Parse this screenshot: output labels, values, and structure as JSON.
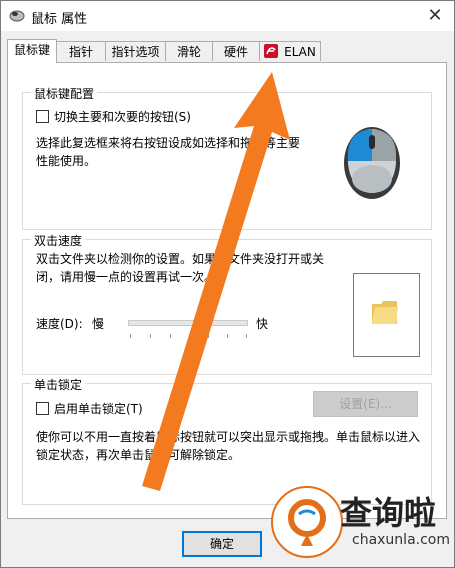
{
  "window": {
    "title": "鼠标 属性",
    "close_glyph": "✕"
  },
  "tabs": [
    {
      "label": "鼠标键",
      "active": true
    },
    {
      "label": "指针"
    },
    {
      "label": "指针选项"
    },
    {
      "label": "滑轮"
    },
    {
      "label": "硬件"
    },
    {
      "label": "ELAN"
    }
  ],
  "button_config": {
    "title": "鼠标键配置",
    "checkbox_label": "切换主要和次要的按钮(S)",
    "description": "选择此复选框来将右按钮设成如选择和拖拉等主要性能使用。",
    "checked": false
  },
  "double_click": {
    "title": "双击速度",
    "description": "双击文件夹以检测你的设置。如果该文件夹没打开或关闭，请用慢一点的设置再试一次。",
    "speed_label": "速度(D):",
    "slow_label": "慢",
    "fast_label": "快",
    "speed_value": 0.64
  },
  "click_lock": {
    "title": "单击锁定",
    "checkbox_label": "启用单击锁定(T)",
    "checked": false,
    "settings_button": "设置(E)...",
    "description": "使你可以不用一直按着鼠标按钮就可以突出显示或拖拽。单击鼠标以进入锁定状态，再次单击鼠标可解除锁定。"
  },
  "footer": {
    "ok_button": "确定"
  },
  "watermark": {
    "brand": "查询啦",
    "url": "chaxunla.com"
  },
  "colors": {
    "accent": "#0078d7",
    "arrow": "#f47a20",
    "elan_red": "#c8102e"
  },
  "icons": {
    "app": "mouse-icon",
    "elan": "elan-logo-icon",
    "folder": "folder-icon"
  }
}
